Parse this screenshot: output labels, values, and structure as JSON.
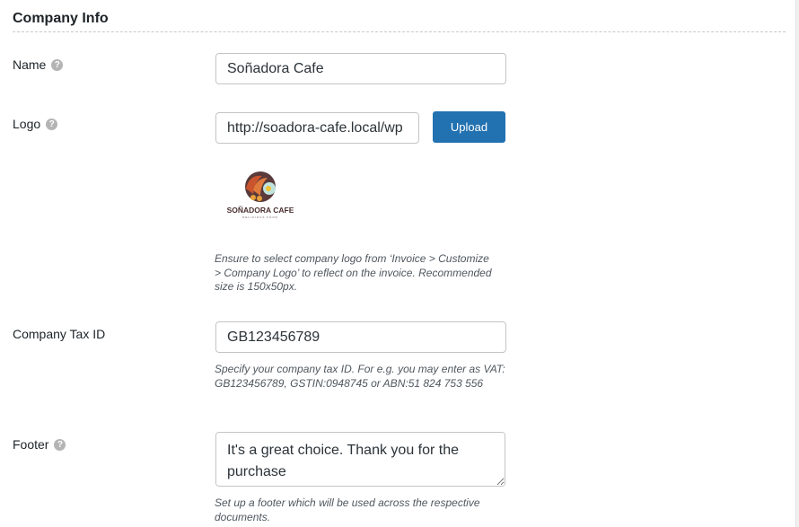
{
  "section_title": "Company Info",
  "fields": {
    "name": {
      "label": "Name",
      "value": "Soñadora Cafe"
    },
    "logo": {
      "label": "Logo",
      "value": "http://soadora-cafe.local/wp",
      "upload_label": "Upload",
      "logo_text": "SOÑADORA CAFE",
      "logo_tagline": "DELICIOUS FOOD",
      "description": "Ensure to select company logo from ‘Invoice > Customize > Company Logo’ to reflect on the invoice. Recommended size is 150x50px."
    },
    "tax_id": {
      "label": "Company Tax ID",
      "value": "GB123456789",
      "description": "Specify your company tax ID. For e.g. you may enter as VAT: GB123456789, GSTIN:0948745 or ABN:51 824 753 556"
    },
    "footer": {
      "label": "Footer",
      "value": "It's a great choice. Thank you for the purchase",
      "description": "Set up a footer which will be used across the respective documents."
    }
  },
  "colors": {
    "accent": "#2271b1"
  }
}
